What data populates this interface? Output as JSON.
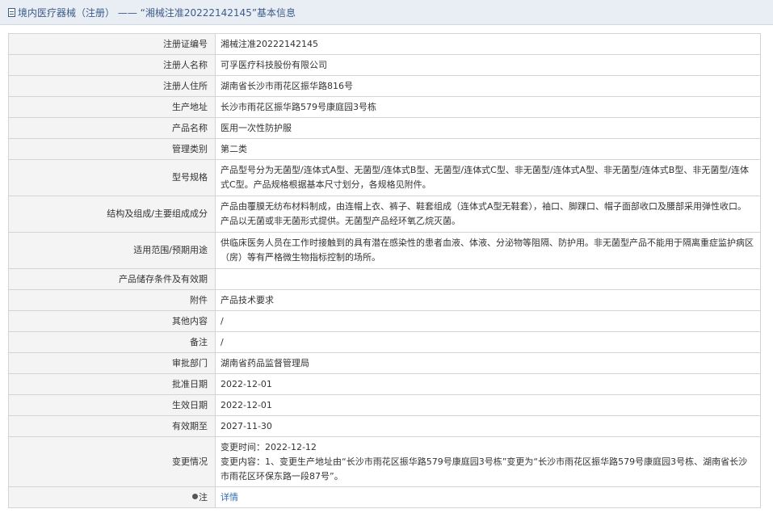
{
  "header": {
    "title": "境内医疗器械（注册） —— “湘械注准20222142145”基本信息",
    "icon": "document-icon"
  },
  "fields": {
    "reg_no": {
      "label": "注册证编号",
      "value": "湘械注准20222142145"
    },
    "registrant": {
      "label": "注册人名称",
      "value": "可孚医疗科技股份有限公司"
    },
    "registrant_address": {
      "label": "注册人住所",
      "value": "湖南省长沙市雨花区振华路816号"
    },
    "production_address": {
      "label": "生产地址",
      "value": "长沙市雨花区振华路579号康庭园3号栋"
    },
    "product_name": {
      "label": "产品名称",
      "value": "医用一次性防护服"
    },
    "management_class": {
      "label": "管理类别",
      "value": "第二类"
    },
    "model_spec": {
      "label": "型号规格",
      "value": "产品型号分为无菌型/连体式A型、无菌型/连体式B型、无菌型/连体式C型、非无菌型/连体式A型、非无菌型/连体式B型、非无菌型/连体式C型。产品规格根据基本尺寸划分，各规格见附件。"
    },
    "structure": {
      "label": "结构及组成/主要组成成分",
      "value": "产品由覆膜无纺布材料制成，由连帽上衣、裤子、鞋套组成（连体式A型无鞋套），袖口、脚踝口、帽子面部收口及腰部采用弹性收口。产品以无菌或非无菌形式提供。无菌型产品经环氧乙烷灭菌。"
    },
    "scope": {
      "label": "适用范围/预期用途",
      "value": "供临床医务人员在工作时接触到的具有潜在感染性的患者血液、体液、分泌物等阻隔、防护用。非无菌型产品不能用于隔离重症监护病区（房）等有严格微生物指标控制的场所。"
    },
    "storage": {
      "label": "产品储存条件及有效期",
      "value": ""
    },
    "attachment": {
      "label": "附件",
      "value": "产品技术要求"
    },
    "other": {
      "label": "其他内容",
      "value": "/"
    },
    "remark": {
      "label": "备注",
      "value": "/"
    },
    "approval_dept": {
      "label": "审批部门",
      "value": "湖南省药品监督管理局"
    },
    "approval_date": {
      "label": "批准日期",
      "value": "2022-12-01"
    },
    "effective_date": {
      "label": "生效日期",
      "value": "2022-12-01"
    },
    "valid_until": {
      "label": "有效期至",
      "value": "2027-11-30"
    },
    "changes": {
      "label": "变更情况",
      "time": "变更时间：2022-12-12",
      "content": "变更内容：1、变更生产地址由“长沙市雨花区振华路579号康庭园3号栋”变更为“长沙市雨花区振华路579号康庭园3号栋、湖南省长沙市雨花区环保东路一段87号”。"
    },
    "note": {
      "label": "注",
      "link": "详情",
      "icon": "pin-icon"
    }
  },
  "colors": {
    "header_bg": "#e9eef4",
    "header_text": "#3b5b8a",
    "label_bg": "#f4f4f4",
    "border": "#d4d4d4",
    "link": "#2f6fb2"
  }
}
